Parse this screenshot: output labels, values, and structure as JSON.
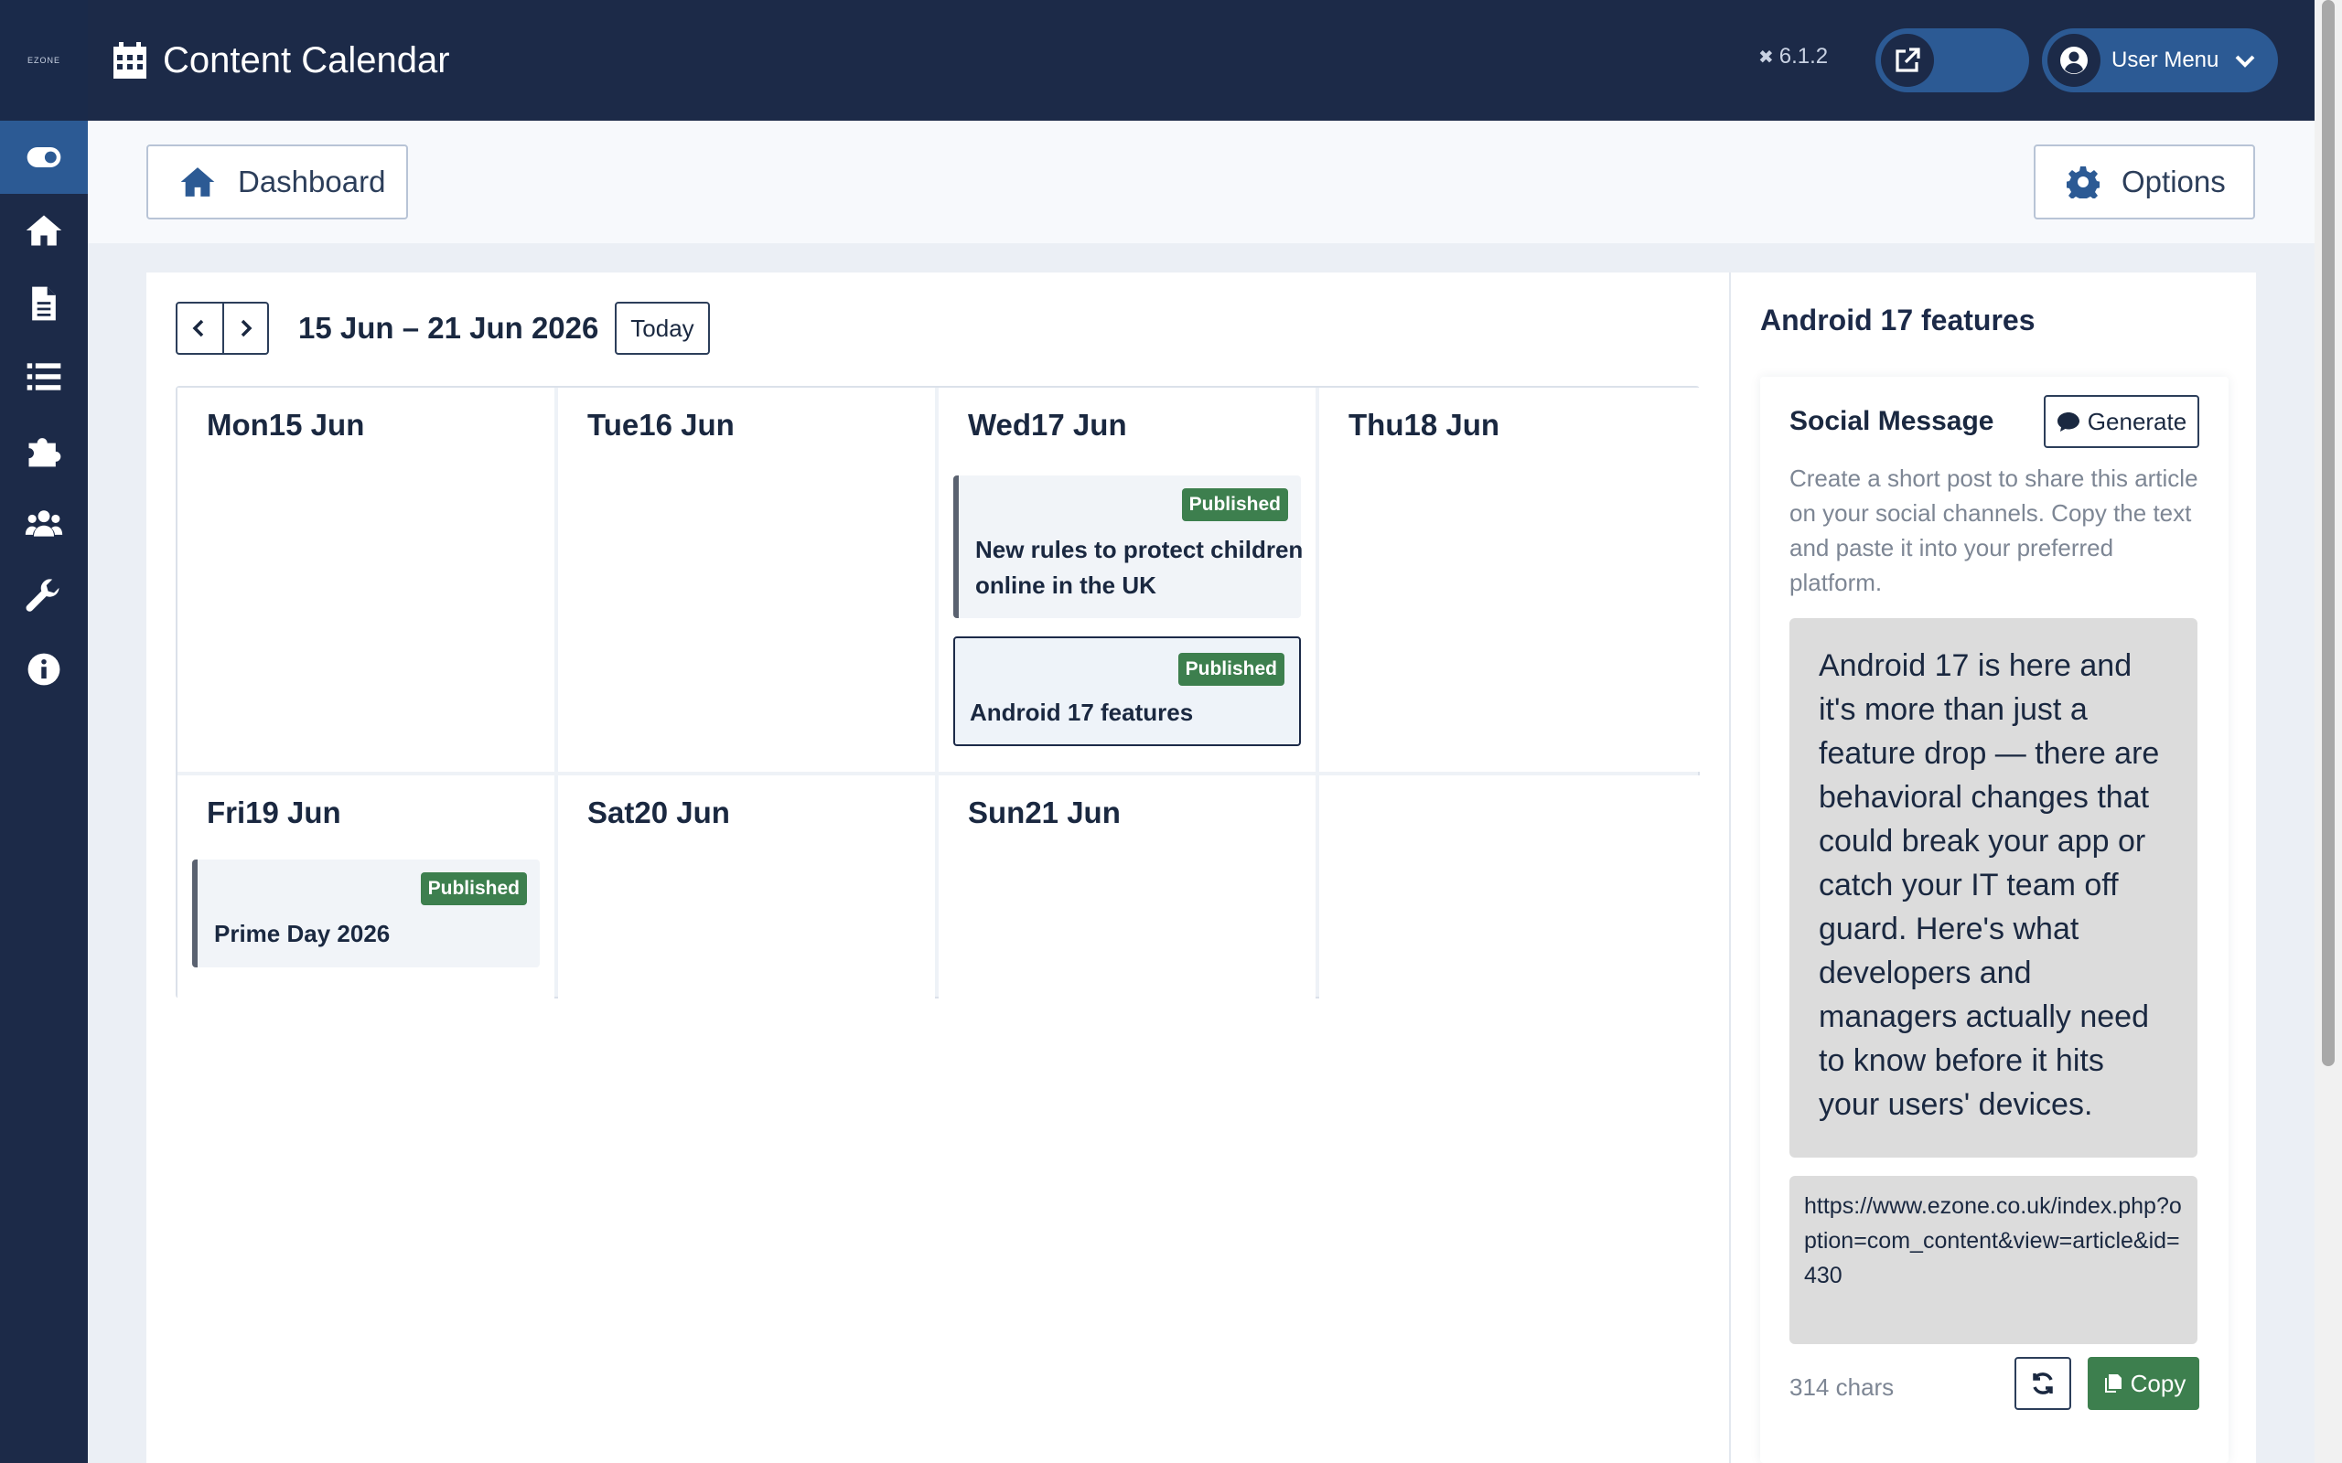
{
  "sidebar": {
    "logo_text": "EZONE",
    "items": [
      {
        "icon": "toggle-icon",
        "active": true
      },
      {
        "icon": "home-icon"
      },
      {
        "icon": "file-icon"
      },
      {
        "icon": "list-icon"
      },
      {
        "icon": "puzzle-icon"
      },
      {
        "icon": "users-icon"
      },
      {
        "icon": "wrench-icon"
      },
      {
        "icon": "info-icon"
      }
    ]
  },
  "header": {
    "title": "Content Calendar",
    "version": "6.1.2",
    "user_menu_label": "User Menu"
  },
  "toolbar": {
    "dashboard_label": "Dashboard",
    "options_label": "Options"
  },
  "calendar": {
    "range": "15 Jun – 21 Jun 2026",
    "today_label": "Today",
    "days": [
      {
        "label": "Mon15 Jun"
      },
      {
        "label": "Tue16 Jun"
      },
      {
        "label": "Wed17 Jun"
      },
      {
        "label": "Thu18 Jun"
      },
      {
        "label": "Fri19 Jun"
      },
      {
        "label": "Sat20 Jun"
      },
      {
        "label": "Sun21 Jun"
      }
    ],
    "events": [
      {
        "day": "Wed17 Jun",
        "title": "New rules to protect children online in the UK",
        "status": "Published"
      },
      {
        "day": "Wed17 Jun",
        "title": "Android 17 features",
        "status": "Published",
        "selected": true
      },
      {
        "day": "Fri19 Jun",
        "title": "Prime Day 2026",
        "status": "Published"
      }
    ]
  },
  "detail": {
    "title": "Android 17 features",
    "social": {
      "heading": "Social Message",
      "generate_label": "Generate",
      "description": "Create a short post to share this article on your social channels. Copy the text and paste it into your preferred platform.",
      "message": "Android 17 is here and it's more than just a feature drop — there are behavioral changes that could break your app or catch your IT team off guard. Here's what developers and managers actually need to know before it hits your users' devices.",
      "url": "https://www.ezone.co.uk/index.php?option=com_content&view=article&id=430",
      "char_count": "314 chars",
      "copy_label": "Copy"
    }
  },
  "colors": {
    "header_bg": "#1c2a48",
    "accent": "#2c5a94",
    "published": "#3d7f4e"
  }
}
